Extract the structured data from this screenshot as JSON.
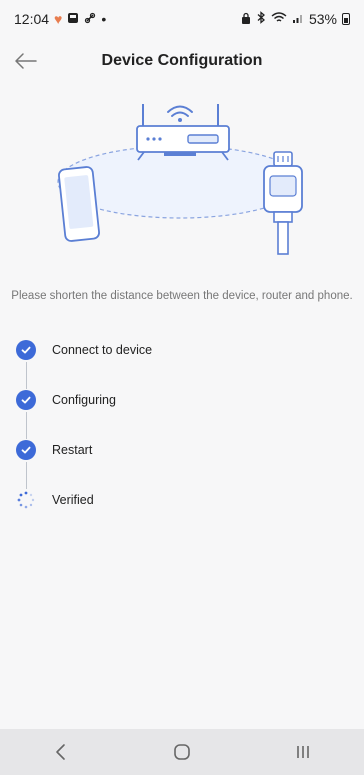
{
  "status_bar": {
    "time": "12:04",
    "battery_percent": "53%"
  },
  "header": {
    "title": "Device Configuration"
  },
  "hint_text": "Please shorten the distance between the device, router and phone.",
  "steps": [
    {
      "label": "Connect to device",
      "state": "done"
    },
    {
      "label": "Configuring",
      "state": "done"
    },
    {
      "label": "Restart",
      "state": "done"
    },
    {
      "label": "Verified",
      "state": "in-progress"
    }
  ],
  "icons": {
    "back": "back-arrow-icon",
    "check": "check-icon",
    "spinner": "loading-spinner-icon",
    "nav_back": "chevron-left-icon",
    "nav_home": "home-icon",
    "nav_recents": "recents-icon"
  },
  "colors": {
    "accent": "#3d6ad8",
    "illustration_stroke": "#5b7fd4",
    "illustration_fill": "#e3ebfb"
  }
}
